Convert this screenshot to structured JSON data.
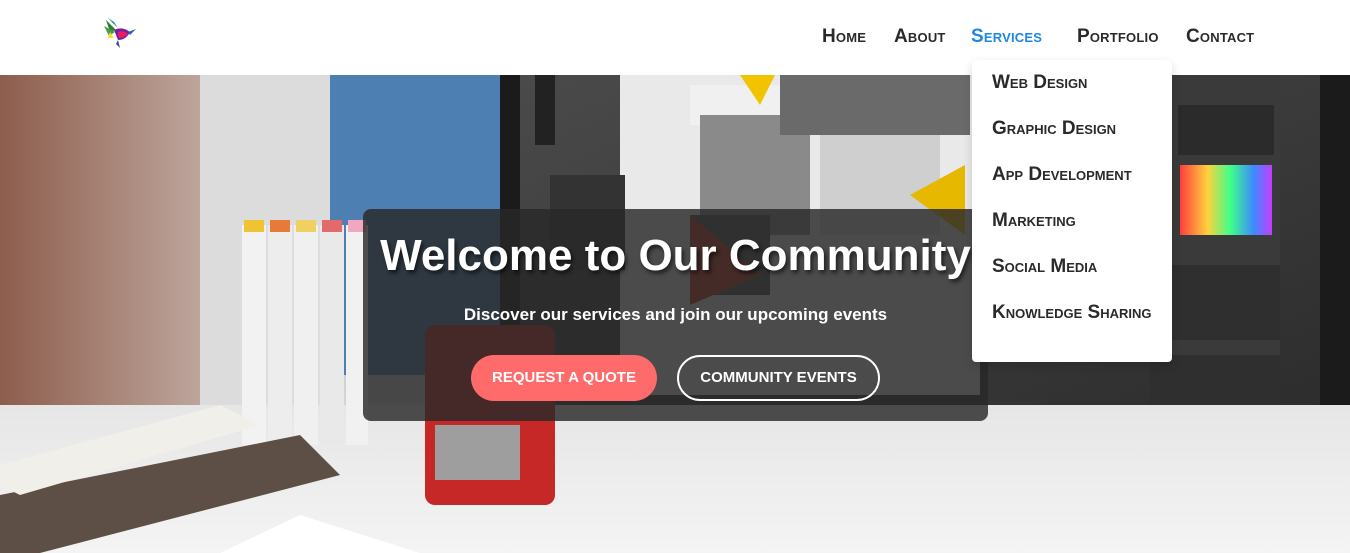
{
  "header": {
    "nav": [
      {
        "label": "Home"
      },
      {
        "label": "About"
      },
      {
        "label": "Services"
      },
      {
        "label": "Portfolio"
      },
      {
        "label": "Contact"
      }
    ],
    "active_color": "#1e88e5"
  },
  "dropdown": {
    "items": [
      {
        "label": "Web Design"
      },
      {
        "label": "Graphic Design"
      },
      {
        "label": "App Development"
      },
      {
        "label": "Marketing"
      },
      {
        "label": "Social Media"
      },
      {
        "label": "Knowledge Sharing"
      }
    ]
  },
  "hero": {
    "title": "Welcome to Our Community",
    "subtitle": "Discover our services and join our upcoming events",
    "primary_button": "REQUEST A QUOTE",
    "secondary_button": "COMMUNITY EVENTS",
    "primary_color": "#ff6b6b"
  },
  "icons": {
    "logo": "hummingbird-logo-icon"
  }
}
